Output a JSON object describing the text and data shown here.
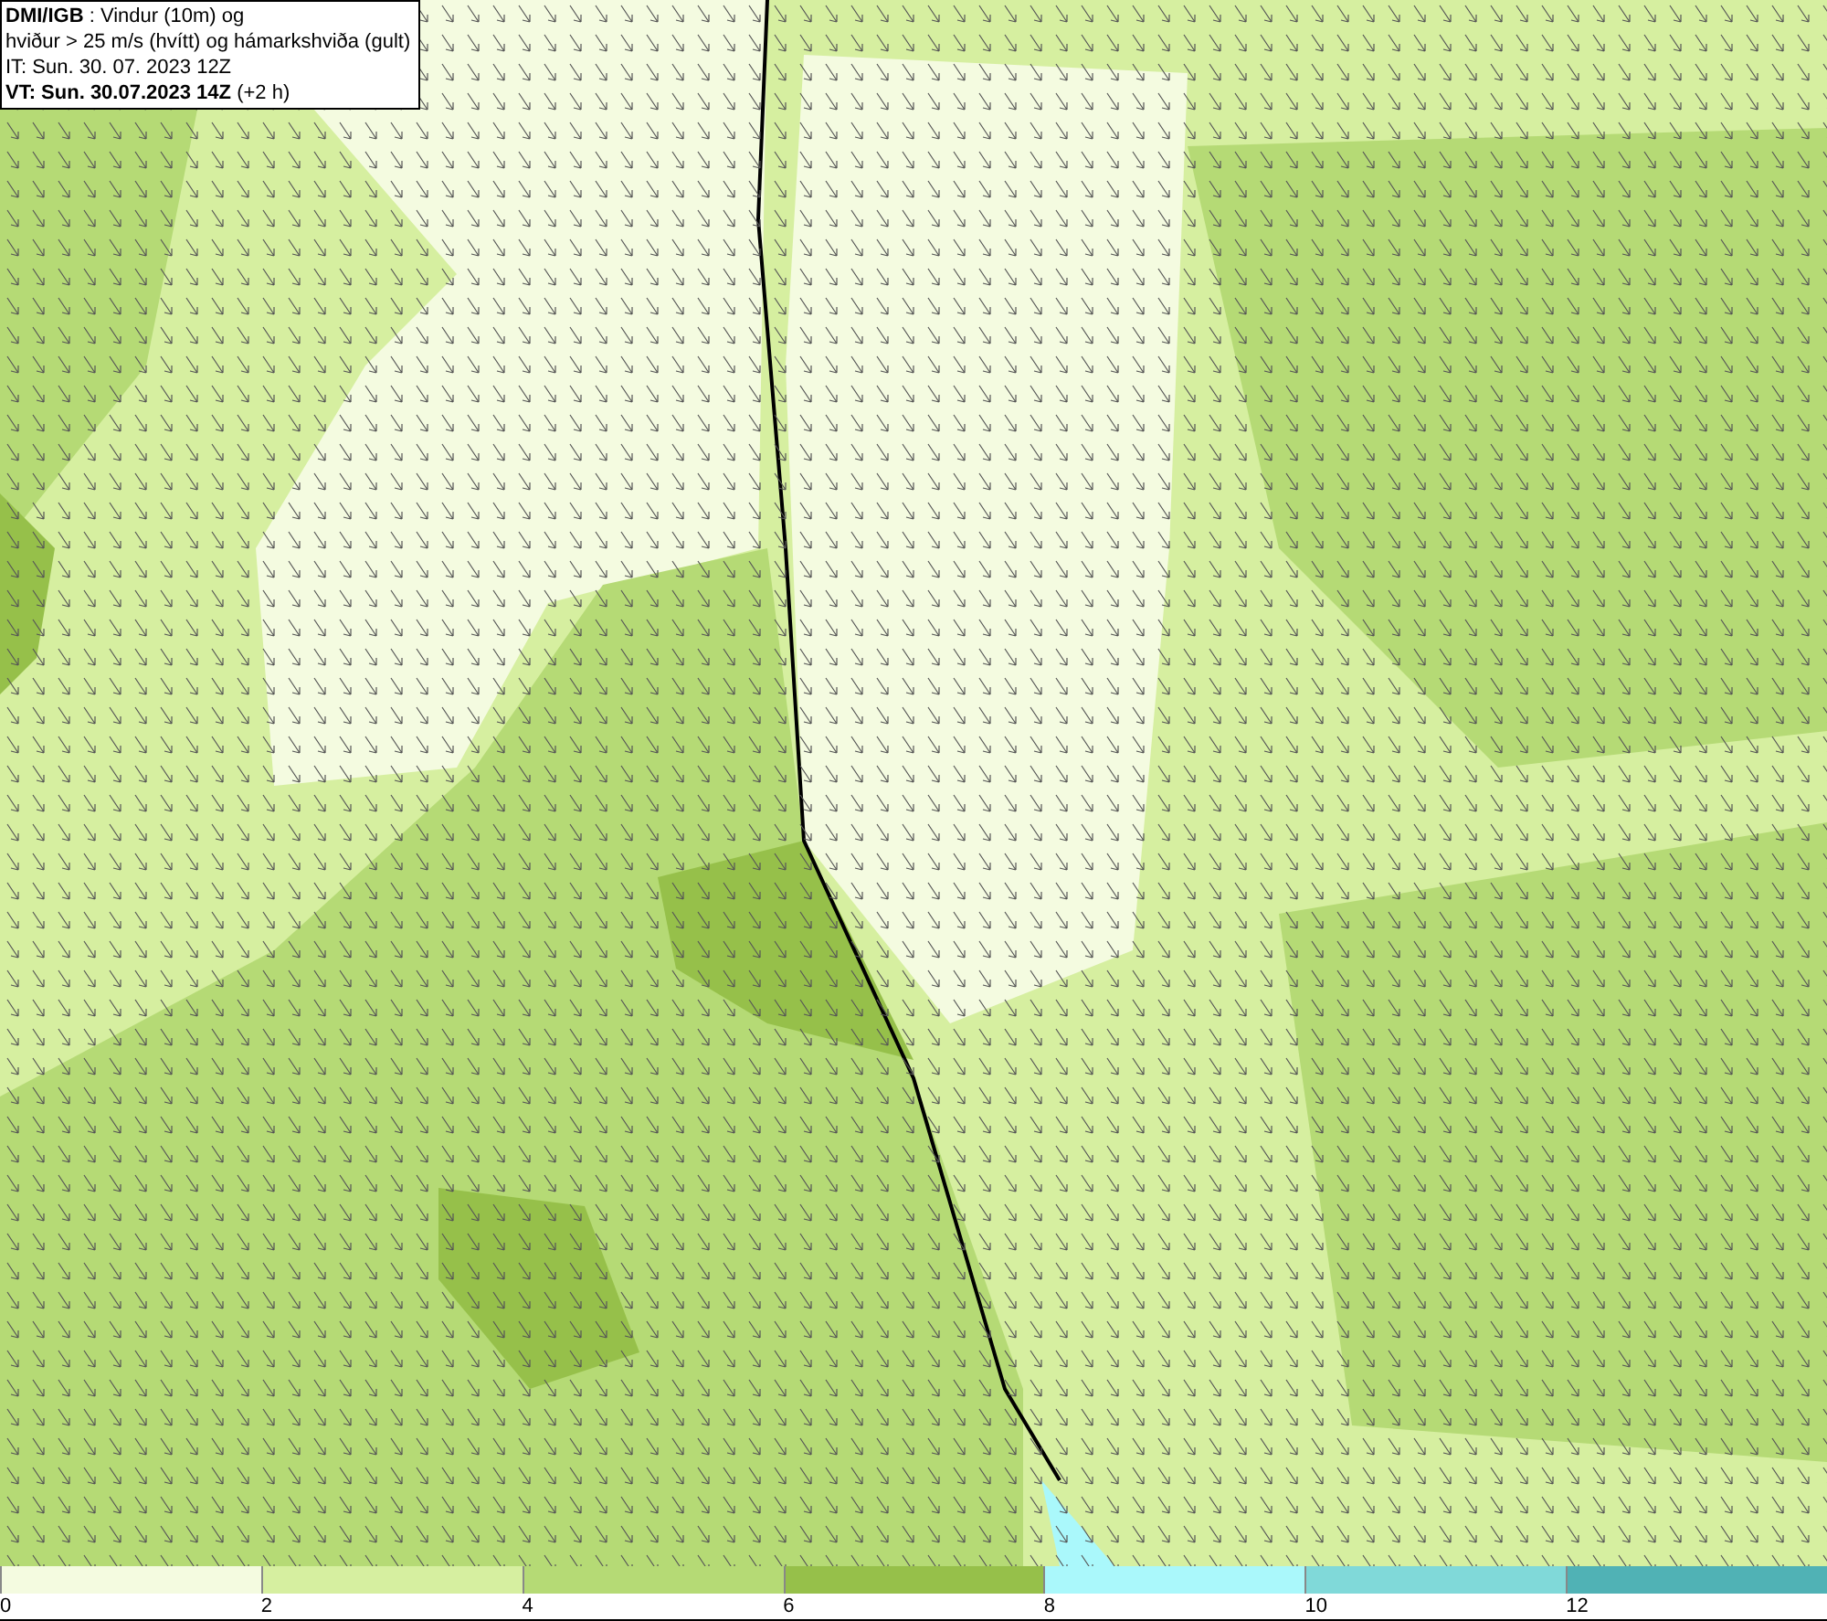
{
  "info_box": {
    "lines": [
      "**DMI/IGB** : Vindur (10m) og",
      "hviður > 25 m/s (hvítt) og hámarkshviða (gult)",
      "IT: Sun. 30. 07. 2023 12Z",
      "**VT: Sun. 30.07.2023 14Z** (+2 h)"
    ]
  },
  "colorbar": {
    "bins": [
      {
        "color": "#f4fbe0"
      },
      {
        "color": "#d6efa0"
      },
      {
        "color": "#b5da75"
      },
      {
        "color": "#96c04a"
      },
      {
        "color": "#aaf8fb"
      },
      {
        "color": "#80d9d9"
      },
      {
        "color": "#50b2b5"
      }
    ],
    "ticks": [
      "0",
      "2",
      "4",
      "6",
      "8",
      "10",
      "12"
    ]
  }
}
